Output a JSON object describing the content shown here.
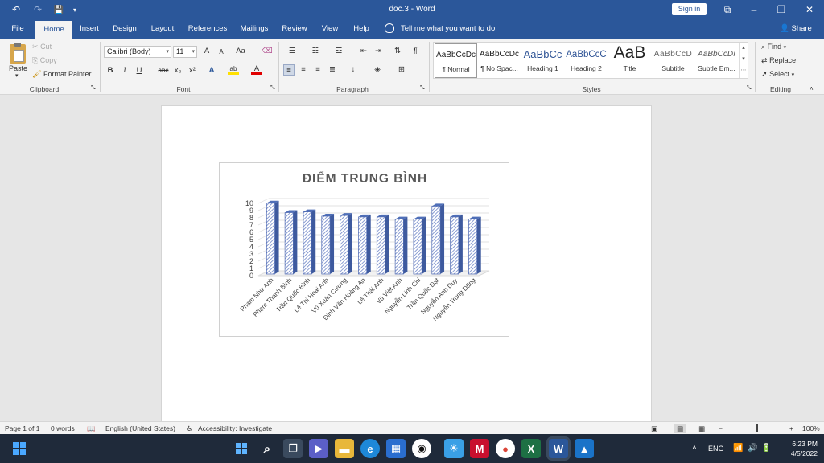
{
  "window": {
    "title": "doc.3 - Word",
    "sign_in": "Sign in",
    "qat": {
      "undo": "↶",
      "redo": "↷",
      "save": "💾",
      "more": "▾"
    },
    "controls": {
      "ribbon_display": "⧉",
      "minimize": "–",
      "restore": "❐",
      "close": "✕"
    }
  },
  "tabs": [
    "File",
    "Home",
    "Insert",
    "Design",
    "Layout",
    "References",
    "Mailings",
    "Review",
    "View",
    "Help"
  ],
  "tell_me": "Tell me what you want to do",
  "share": "Share",
  "ribbon": {
    "clipboard": {
      "label": "Clipboard",
      "paste": "Paste",
      "cut": "Cut",
      "copy": "Copy",
      "format_painter": "Format Painter"
    },
    "font": {
      "label": "Font",
      "family": "Calibri (Body)",
      "size": "11",
      "grow": "A",
      "shrink": "A",
      "case": "Aa",
      "bold": "B",
      "italic": "I",
      "underline": "U",
      "strike": "abc",
      "subscript": "x₂",
      "superscript": "x²",
      "effects": "A",
      "highlight": "ab",
      "color": "A"
    },
    "paragraph": {
      "label": "Paragraph",
      "pilcrow": "¶"
    },
    "styles": {
      "label": "Styles",
      "items": [
        {
          "preview": "AaBbCcDc",
          "name": "¶ Normal"
        },
        {
          "preview": "AaBbCcDc",
          "name": "¶ No Spac..."
        },
        {
          "preview": "AaBbCc",
          "name": "Heading 1"
        },
        {
          "preview": "AaBbCcC",
          "name": "Heading 2"
        },
        {
          "preview": "AaB",
          "name": "Title"
        },
        {
          "preview": "AaBbCcD",
          "name": "Subtitle"
        },
        {
          "preview": "AaBbCcDı",
          "name": "Subtle Em..."
        }
      ]
    },
    "editing": {
      "label": "Editing",
      "find": "Find",
      "replace": "Replace",
      "select": "Select"
    }
  },
  "chart_data": {
    "type": "bar",
    "title": "ĐIỂM TRUNG BÌNH",
    "categories": [
      "Phạm Như Anh",
      "Phạm Thanh Bình",
      "Trần Quốc Bình",
      "Lê Thị Hoài Anh",
      "Vũ Xuân Cương",
      "Đinh Văn Hoàng An",
      "Lê Thái Anh",
      "Vũ Việt Anh",
      "Nguyễn Linh Chi",
      "Trần Quốc Đạt",
      "Nguyễn Anh Duy",
      "Nguyễn Trung Dũng"
    ],
    "values": [
      9.8,
      8.5,
      8.6,
      8.0,
      8.1,
      7.9,
      7.9,
      7.6,
      7.6,
      9.4,
      7.9,
      7.6
    ],
    "yticks": [
      "0",
      "1",
      "2",
      "3",
      "4",
      "5",
      "6",
      "7",
      "8",
      "9",
      "10"
    ],
    "ylim": [
      0,
      10
    ],
    "grid": true,
    "bar_color": "#6f86c8"
  },
  "status": {
    "page": "Page 1 of 1",
    "words": "0 words",
    "language": "English (United States)",
    "accessibility": "Accessibility: Investigate",
    "zoom": "100%"
  },
  "taskbar": {
    "apps": [
      "start",
      "search",
      "task-view",
      "teams",
      "explorer",
      "edge",
      "store",
      "feedback",
      "mcafee",
      "chrome",
      "excel",
      "word",
      "photos"
    ],
    "lang": "ENG",
    "time": "6:23 PM",
    "date": "4/5/2022"
  }
}
